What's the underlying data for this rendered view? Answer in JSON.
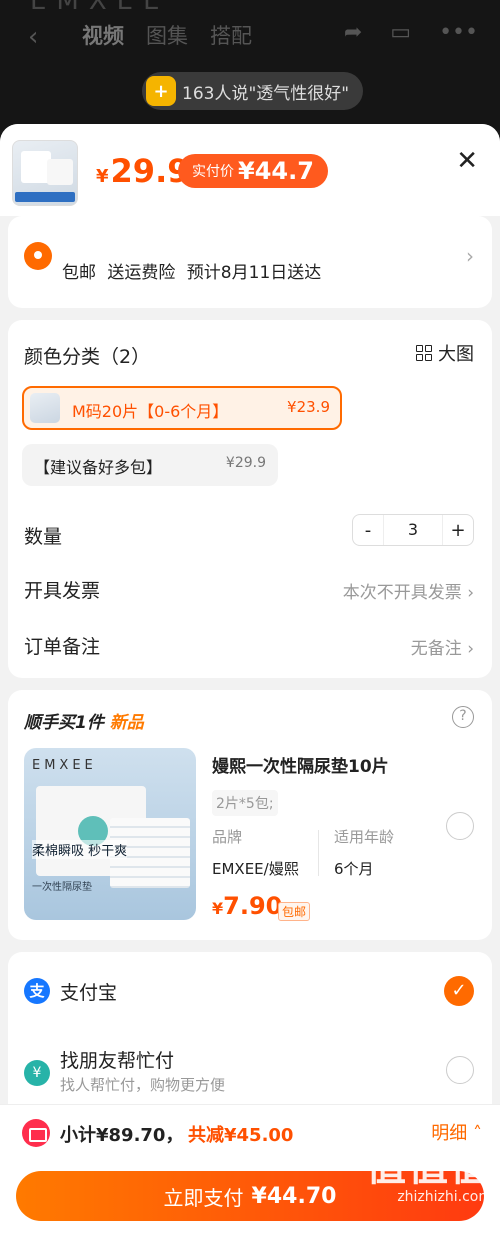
{
  "background": {
    "brand": "EMXEE",
    "tabs": [
      "视频",
      "图集",
      "搭配"
    ],
    "pill_text": "163人说\"透气性很好\""
  },
  "header": {
    "currency": "¥",
    "price": "29.9",
    "real_label": "实付价",
    "real_price": "¥44.7",
    "close": "✕"
  },
  "shipping": {
    "text": "包邮 送运费险 预计8月11日送达"
  },
  "options": {
    "title": "颜色分类（2）",
    "big_view": "大图",
    "skus": [
      {
        "name": "M码20片【0-6个月】",
        "price": "¥23.9",
        "selected": true
      },
      {
        "name": "【建议备好多包】",
        "price": "¥29.9",
        "selected": false
      }
    ],
    "quantity_label": "数量",
    "quantity": "3",
    "minus": "-",
    "plus": "+",
    "invoice_label": "开具发票",
    "invoice_value": "本次不开具发票",
    "note_label": "订单备注",
    "note_value": "无备注"
  },
  "addon": {
    "title_prefix": "顺手买1件",
    "title_new": "新品",
    "name": "嫚熙一次性隔尿垫10片",
    "spec": "2片*5包;",
    "brand_label": "品牌",
    "brand_value": "EMXEE/嫚熙",
    "age_label": "适用年龄",
    "age_value": "6个月",
    "currency": "¥",
    "price": "7.90",
    "free_ship": "包邮",
    "image_logo": "EMXEE",
    "image_caption": "柔棉瞬吸 秒干爽",
    "image_subcaption": "一次性隔尿垫"
  },
  "payment": {
    "alipay_label": "支付宝",
    "friend_label": "找朋友帮忙付",
    "friend_sub": "找人帮忙付，购物更方便"
  },
  "footer": {
    "subtotal": "小计¥89.70，",
    "discount": "共减¥45.00",
    "detail": "明细",
    "pay_label": "立即支付",
    "pay_amount": "¥44.70",
    "watermark_big": "值值值",
    "watermark_url": "zhizhizhi.com"
  },
  "colors": {
    "accent": "#ff5000",
    "orange": "#ff6a00",
    "alipay": "#1677ff"
  }
}
